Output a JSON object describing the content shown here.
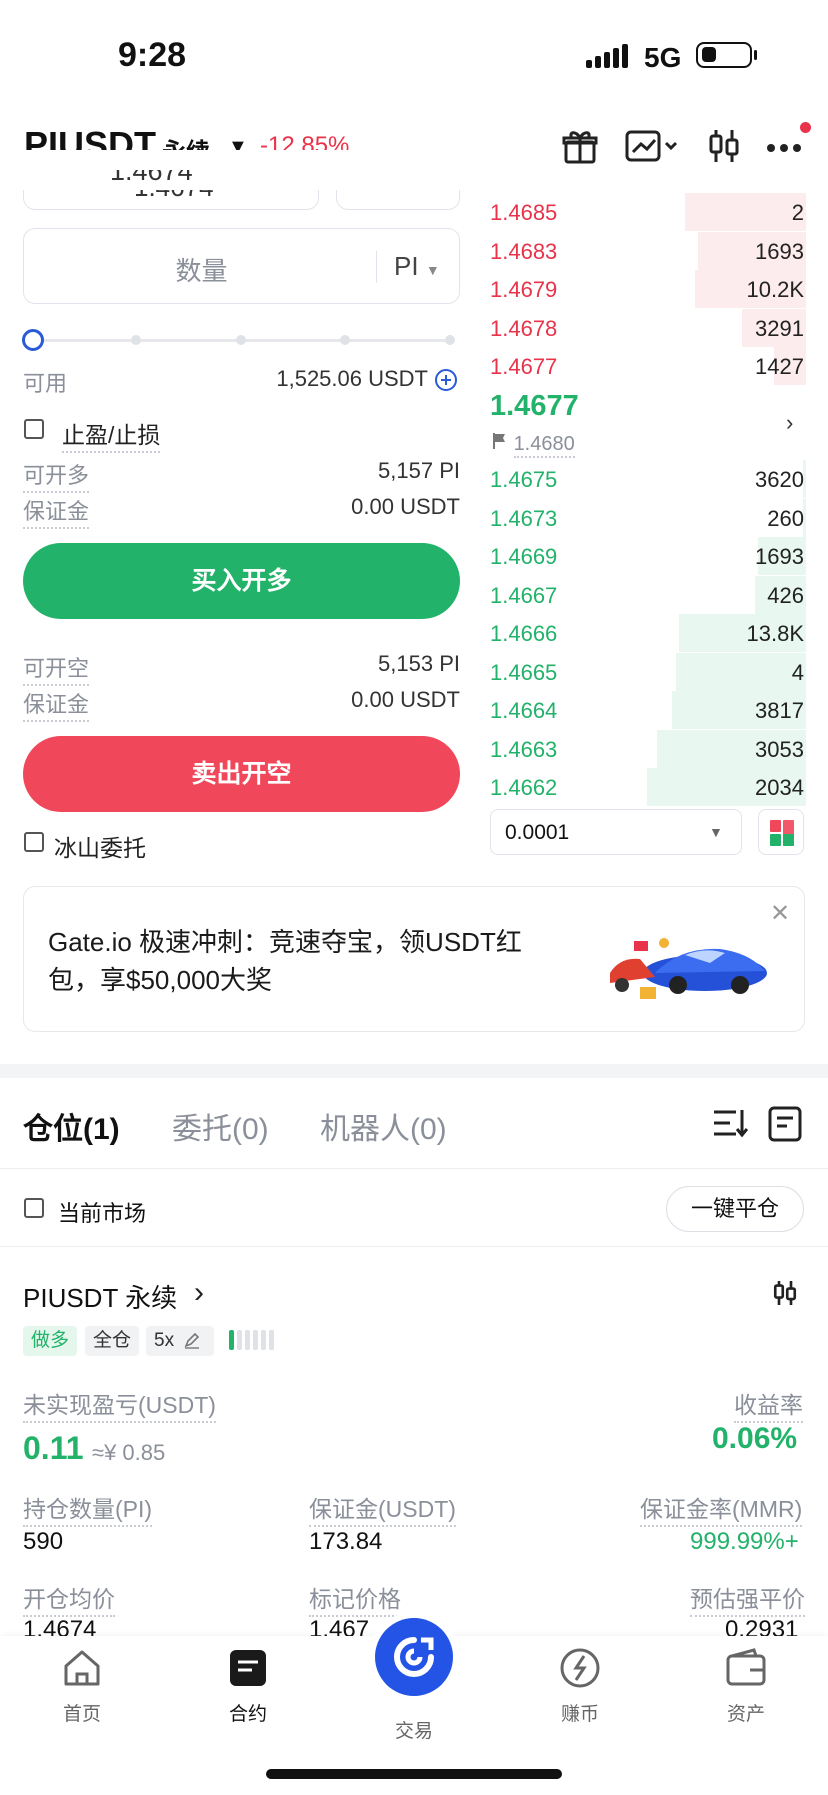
{
  "status_bar": {
    "time": "9:28",
    "network": "5G"
  },
  "header": {
    "pair": "PIUSDT",
    "type": "永续",
    "change": "-12.85%"
  },
  "order_form": {
    "price_partial": "1.4674",
    "qty_placeholder": "数量",
    "qty_unit": "PI",
    "available_label": "可用",
    "available_value": "1,525.06 USDT",
    "tpsl_label": "止盈/止损",
    "long": {
      "max_label": "可开多",
      "max_value": "5,157 PI",
      "margin_label": "保证金",
      "margin_value": "0.00 USDT",
      "button": "买入开多"
    },
    "short": {
      "max_label": "可开空",
      "max_value": "5,153 PI",
      "margin_label": "保证金",
      "margin_value": "0.00 USDT",
      "button": "卖出开空"
    },
    "iceberg_label": "冰山委托"
  },
  "order_book": {
    "asks": [
      {
        "price": "1.4685",
        "size": "2",
        "depth": 0.38
      },
      {
        "price": "1.4683",
        "size": "1693",
        "depth": 0.34
      },
      {
        "price": "1.4679",
        "size": "10.2K",
        "depth": 0.35
      },
      {
        "price": "1.4678",
        "size": "3291",
        "depth": 0.2
      },
      {
        "price": "1.4677",
        "size": "1427",
        "depth": 0.1
      }
    ],
    "mid_price": "1.4677",
    "mark_price": "1.4680",
    "bids": [
      {
        "price": "1.4675",
        "size": "3620",
        "depth": 0.01
      },
      {
        "price": "1.4673",
        "size": "260",
        "depth": 0.01
      },
      {
        "price": "1.4669",
        "size": "1693",
        "depth": 0.15
      },
      {
        "price": "1.4667",
        "size": "426",
        "depth": 0.16
      },
      {
        "price": "1.4666",
        "size": "13.8K",
        "depth": 0.4
      },
      {
        "price": "1.4665",
        "size": "4",
        "depth": 0.41
      },
      {
        "price": "1.4664",
        "size": "3817",
        "depth": 0.42
      },
      {
        "price": "1.4663",
        "size": "3053",
        "depth": 0.47
      },
      {
        "price": "1.4662",
        "size": "2034",
        "depth": 0.5
      }
    ],
    "tick_size": "0.0001"
  },
  "promo": {
    "text": "Gate.io 极速冲刺：竞速夺宝，领USDT红包，享$50,000大奖"
  },
  "positions": {
    "tabs": [
      "仓位(1)",
      "委托(0)",
      "机器人(0)"
    ],
    "current_market_label": "当前市场",
    "close_all": "一键平仓",
    "card": {
      "title": "PIUSDT 永续",
      "tags": {
        "side": "做多",
        "mode": "全仓",
        "leverage": "5x"
      },
      "pnl_label": "未实现盈亏(USDT)",
      "pnl_value": "0.11",
      "pnl_cny": "≈¥ 0.85",
      "roe_label": "收益率",
      "roe_value": "0.06%",
      "size_label": "持仓数量(PI)",
      "size_value": "590",
      "margin_label": "保证金(USDT)",
      "margin_value": "173.84",
      "mmr_label": "保证金率(MMR)",
      "mmr_value": "999.99%+",
      "entry_label": "开仓均价",
      "entry_value": "1.4674",
      "mark_label": "标记价格",
      "mark_value": "1.467",
      "liq_label": "预估强平价",
      "liq_value": "0.2931"
    }
  },
  "bottom_nav": [
    {
      "label": "首页",
      "icon": "home-icon"
    },
    {
      "label": "合约",
      "icon": "contract-icon"
    },
    {
      "label": "交易",
      "icon": "trade-icon"
    },
    {
      "label": "赚币",
      "icon": "earn-icon"
    },
    {
      "label": "资产",
      "icon": "wallet-icon"
    }
  ],
  "colors": {
    "buy": "#22b26a",
    "sell": "#f0475a",
    "accent": "#2354e6"
  }
}
